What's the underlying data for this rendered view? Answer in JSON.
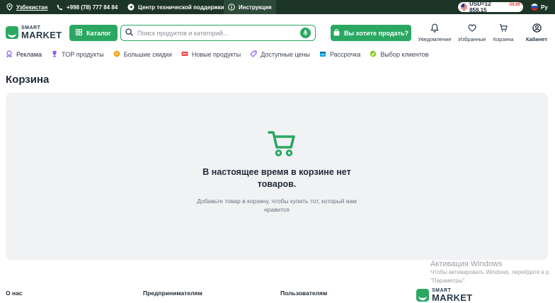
{
  "topbar": {
    "region": "Узбекистан",
    "phone": "+998 (78) 777 84 84",
    "support": "Центр технической поддержки",
    "instruction": "Инструкция",
    "currency": "USD=12 858.15",
    "currency_delta": "-58.95",
    "language": "Ру"
  },
  "header": {
    "logo_small": "SMART",
    "logo_big": "MARKET",
    "catalog_label": "Каталог",
    "search_placeholder": "Поиск продуктов и категорий...",
    "sell_label": "Вы хотите продать?",
    "icons": [
      {
        "label": "Уведомление"
      },
      {
        "label": "Избранные"
      },
      {
        "label": "Корзина"
      },
      {
        "label": "Кабинет"
      }
    ]
  },
  "nav": {
    "items": [
      "Реклама",
      "ТОР продукты",
      "Большие скидки",
      "Новые продукты",
      "Доступные цены",
      "Рассрочка",
      "Выбор клиентов"
    ]
  },
  "page": {
    "title": "Корзина"
  },
  "cart": {
    "empty_title": "В настоящее время в корзине нет товаров.",
    "empty_subtitle": "Добавьте товар в корзину, чтобы купить тот, который вам нравится"
  },
  "footer": {
    "cols": [
      "О нас",
      "Предпринимателям",
      "Пользователям"
    ],
    "logo_small": "SMART",
    "logo_big": "MARKET"
  },
  "watermark": {
    "title": "Активация Windows",
    "line1": "Чтобы активировать Windows, перейдите в р",
    "line2": "\"Параметры\"."
  },
  "colors": {
    "brand_green": "#2aa862",
    "topbar_bg": "#1d3527",
    "cart_box_bg": "#f1f2f4",
    "delta_red": "#e53935"
  }
}
